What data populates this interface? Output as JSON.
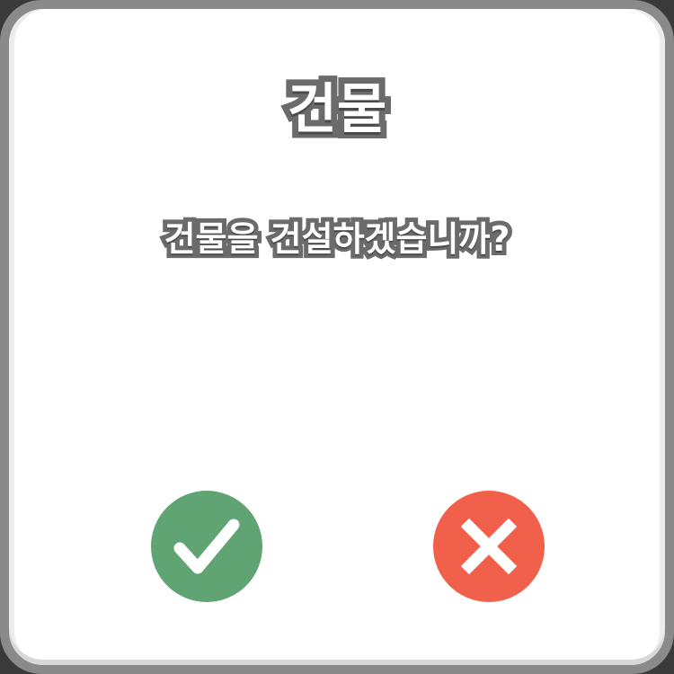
{
  "dialog": {
    "title": "건물",
    "message": "건물을 건설하겠습니까?",
    "confirm": {
      "icon": "checkmark-icon",
      "color": "#5fa472"
    },
    "cancel": {
      "icon": "x-mark-icon",
      "color": "#f0604a"
    }
  }
}
